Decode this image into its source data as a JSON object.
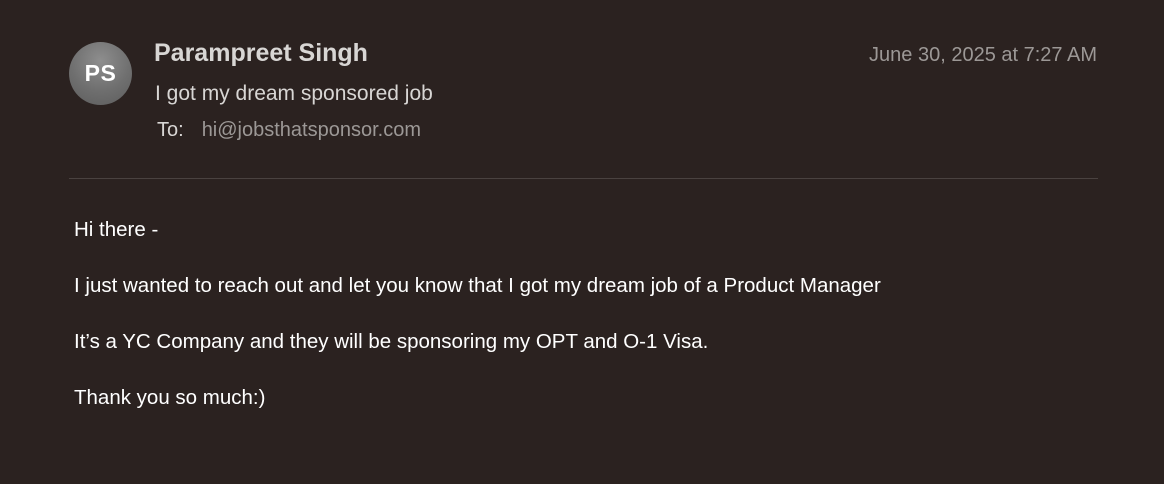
{
  "email": {
    "avatar_initials": "PS",
    "sender_name": "Parampreet Singh",
    "date": "June 30, 2025 at 7:27 AM",
    "subject": "I got my dream sponsored job",
    "to_label": "To:",
    "to_address": "hi@jobsthatsponsor.com",
    "body": [
      "Hi there -",
      "I just wanted to reach out and let you know that I got my dream job of a Product Manager",
      "It’s a YC Company and they will be sponsoring my OPT and O-1 Visa.",
      "Thank you so much:)"
    ]
  },
  "colors": {
    "background": "#2b2220",
    "avatar": "#7a7a7a",
    "primary_text": "#d8d6d4",
    "secondary_text": "#9c9896",
    "body_text": "#ffffff",
    "divider": "#4a4240"
  }
}
